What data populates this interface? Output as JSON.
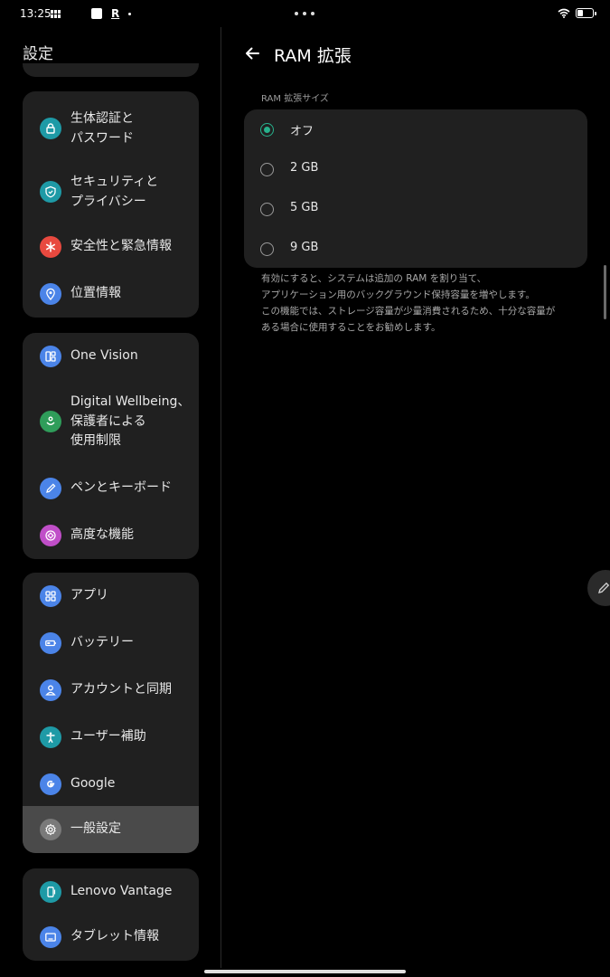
{
  "status_bar": {
    "time": "13:25",
    "app_letter": "R"
  },
  "sidebar": {
    "title": "設定",
    "groups": [
      {
        "items": [
          {
            "label": "生体認証と\nパスワード",
            "icon": "lock-icon",
            "color": "#1e9aa6"
          },
          {
            "label": "セキュリティと\nプライバシー",
            "icon": "shield-icon",
            "color": "#1e9aa6"
          },
          {
            "label": "安全性と緊急情報",
            "icon": "asterisk-icon",
            "color": "#e8493f"
          },
          {
            "label": "位置情報",
            "icon": "location-pin-icon",
            "color": "#4b84e8"
          }
        ]
      },
      {
        "items": [
          {
            "label": "One Vision",
            "icon": "dashboard-icon",
            "color": "#4b84e8"
          },
          {
            "label": "Digital Wellbeing、\n保護者による\n使用制限",
            "icon": "wellbeing-icon",
            "color": "#2f9d5a"
          },
          {
            "label": "ペンとキーボード",
            "icon": "pen-icon",
            "color": "#4b84e8"
          },
          {
            "label": "高度な機能",
            "icon": "advanced-features-icon",
            "color": "#c04ec8"
          }
        ]
      },
      {
        "items": [
          {
            "label": "アプリ",
            "icon": "apps-grid-icon",
            "color": "#4b84e8"
          },
          {
            "label": "バッテリー",
            "icon": "battery-icon",
            "color": "#4b84e8"
          },
          {
            "label": "アカウントと同期",
            "icon": "account-icon",
            "color": "#4b84e8"
          },
          {
            "label": "ユーザー補助",
            "icon": "accessibility-icon",
            "color": "#1e9aa6"
          },
          {
            "label": "Google",
            "icon": "google-icon",
            "color": "#4b84e8"
          },
          {
            "label": "一般設定",
            "icon": "gear-icon",
            "color": "#7a7a7a",
            "selected": true
          }
        ]
      },
      {
        "items": [
          {
            "label": "Lenovo Vantage",
            "icon": "phone-icon",
            "color": "#1e9aa6"
          },
          {
            "label": "タブレット情報",
            "icon": "tablet-icon",
            "color": "#4b84e8"
          }
        ]
      }
    ]
  },
  "detail": {
    "title": "RAM 拡張",
    "section_label": "RAM 拡張サイズ",
    "options": [
      {
        "label": "オフ",
        "selected": true
      },
      {
        "label": "2 GB",
        "selected": false
      },
      {
        "label": "5 GB",
        "selected": false
      },
      {
        "label": "9 GB",
        "selected": false
      }
    ],
    "description": [
      "有効にすると、システムは追加の RAM を割り当て、",
      "アプリケーション用のバックグラウンド保持容量を増やします。",
      "この機能では、ストレージ容量が少量消費されるため、十分な容量が",
      "ある場合に使用することをお勧めします。"
    ]
  },
  "colors": {
    "accent": "#27b18c",
    "card_bg": "#202020",
    "selected_bg": "#4a4a4a"
  }
}
